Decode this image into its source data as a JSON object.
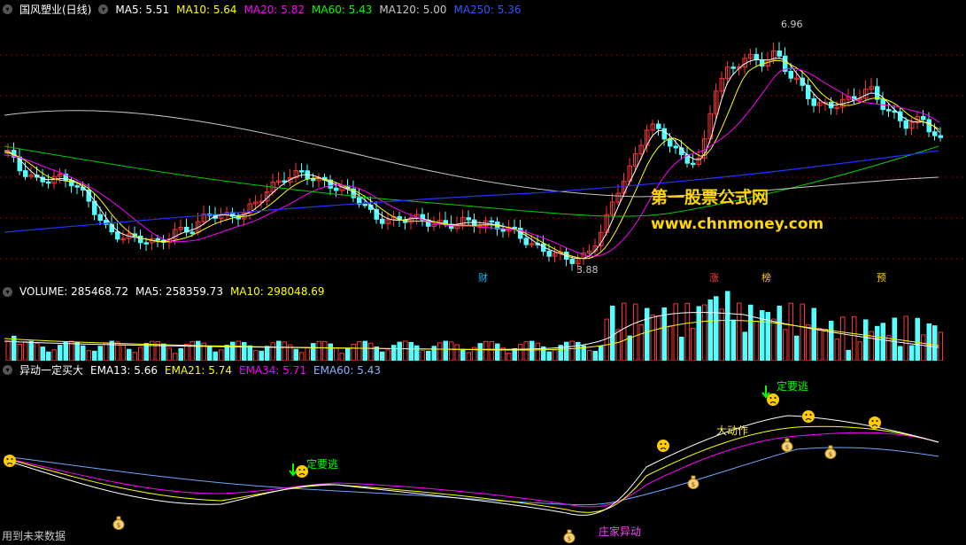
{
  "price": {
    "title": "国风塑业(日线)",
    "ma": [
      {
        "label": "MA5: 5.51",
        "color": "#ffffff"
      },
      {
        "label": "MA10: 5.64",
        "color": "#ffff00"
      },
      {
        "label": "MA20: 5.82",
        "color": "#ff00ff"
      },
      {
        "label": "MA60: 5.43",
        "color": "#00ff00"
      },
      {
        "label": "MA120: 5.00",
        "color": "#c8c8c8"
      },
      {
        "label": "MA250: 5.36",
        "color": "#0000ff"
      }
    ],
    "high_label": "6.96",
    "low_label": "3.88",
    "event_tags": [
      {
        "text": "财",
        "color": "#00bfff"
      },
      {
        "text": "涨",
        "color": "#ff4040"
      },
      {
        "text": "榜",
        "color": "#ffcc00"
      },
      {
        "text": "预",
        "color": "#ffcc00"
      }
    ],
    "watermark_cn": "第一股票公式网",
    "watermark_url": "www.chnmoney.com"
  },
  "volume": {
    "label": "VOLUME: 285468.72",
    "ma5": "MA5: 258359.73",
    "ma10": "MA10: 298048.69"
  },
  "indicator": {
    "name": "异动一定买大",
    "ema13": "EMA13: 5.66",
    "ema21": "EMA21: 5.74",
    "ema34": "EMA34: 5.71",
    "ema60": "EMA60: 5.43",
    "annotations": {
      "escape_1": "定要逃",
      "escape_2": "定要逃",
      "big_move": "大动作",
      "dealer": "庄家异动"
    },
    "footer": "用到未来数据"
  },
  "colors": {
    "up": "#ff3232",
    "down": "#54ffff",
    "grid": "#8b0000"
  }
}
